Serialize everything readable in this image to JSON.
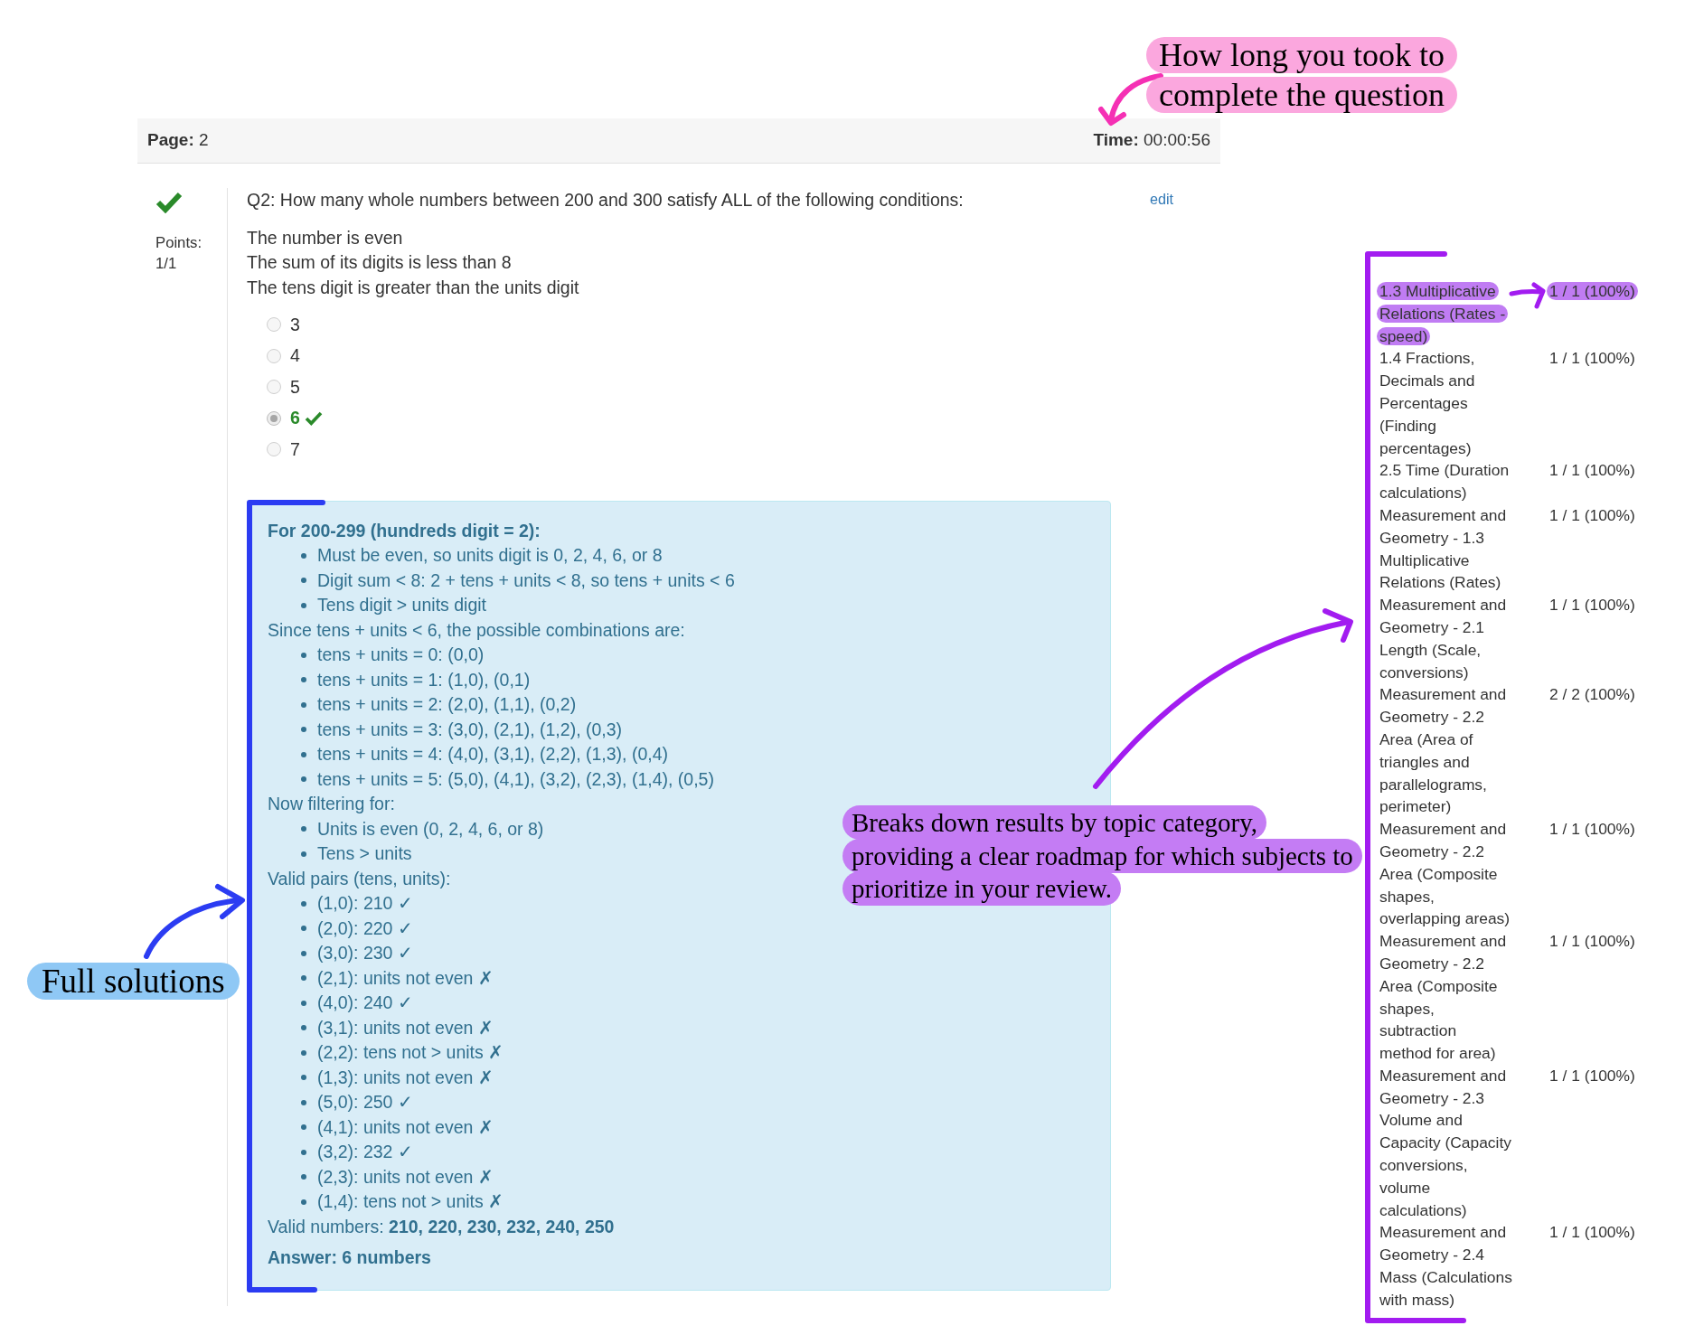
{
  "header": {
    "page": "**Page:** 2",
    "time": "**Time:** 00:00:56"
  },
  "question": {
    "correct": true,
    "points_label": "Points:",
    "points": "1/1",
    "title": "Q2: How many whole numbers between 200 and 300 satisfy ALL of the following conditions:",
    "edit_link": "edit",
    "conditions": [
      "The number is even",
      "The sum of its digits is less than 8",
      "The tens digit is greater than the units digit"
    ],
    "options": [
      {
        "label": "3",
        "selected": false,
        "correct": false
      },
      {
        "label": "4",
        "selected": false,
        "correct": false
      },
      {
        "label": "5",
        "selected": false,
        "correct": false
      },
      {
        "label": "6",
        "selected": true,
        "correct": true
      },
      {
        "label": "7",
        "selected": false,
        "correct": false
      }
    ]
  },
  "solution": {
    "lines": [
      {
        "kind": "heading",
        "text": "For 200-299 (hundreds digit = 2):"
      },
      {
        "kind": "bullet",
        "text": "Must be even, so units digit is 0, 2, 4, 6, or 8"
      },
      {
        "kind": "bullet",
        "text": "Digit sum < 8: 2 + tens + units < 8, so tens + units < 6"
      },
      {
        "kind": "bullet",
        "text": "Tens digit > units digit"
      },
      {
        "kind": "text",
        "text": "Since tens + units < 6, the possible combinations are:"
      },
      {
        "kind": "bullet",
        "text": "tens + units = 0: (0,0)"
      },
      {
        "kind": "bullet",
        "text": "tens + units = 1: (1,0), (0,1)"
      },
      {
        "kind": "bullet",
        "text": "tens + units = 2: (2,0), (1,1), (0,2)"
      },
      {
        "kind": "bullet",
        "text": "tens + units = 3: (3,0), (2,1), (1,2), (0,3)"
      },
      {
        "kind": "bullet",
        "text": "tens + units = 4: (4,0), (3,1), (2,2), (1,3), (0,4)"
      },
      {
        "kind": "bullet",
        "text": "tens + units = 5: (5,0), (4,1), (3,2), (2,3), (1,4), (0,5)"
      },
      {
        "kind": "text",
        "text": "Now filtering for:"
      },
      {
        "kind": "bullet",
        "text": "Units is even (0, 2, 4, 6, or 8)"
      },
      {
        "kind": "bullet",
        "text": "Tens > units"
      },
      {
        "kind": "text",
        "text": "Valid pairs (tens, units):"
      },
      {
        "kind": "bullet",
        "text": "(1,0): 210 ✓"
      },
      {
        "kind": "bullet",
        "text": "(2,0): 220 ✓"
      },
      {
        "kind": "bullet",
        "text": "(3,0): 230 ✓"
      },
      {
        "kind": "bullet",
        "text": "(2,1): units not even ✗"
      },
      {
        "kind": "bullet",
        "text": "(4,0): 240 ✓"
      },
      {
        "kind": "bullet",
        "text": "(3,1): units not even ✗"
      },
      {
        "kind": "bullet",
        "text": "(2,2): tens not > units ✗"
      },
      {
        "kind": "bullet",
        "text": "(1,3): units not even ✗"
      },
      {
        "kind": "bullet",
        "text": "(5,0): 250 ✓"
      },
      {
        "kind": "bullet",
        "text": "(4,1): units not even ✗"
      },
      {
        "kind": "bullet",
        "text": "(3,2): 232 ✓"
      },
      {
        "kind": "bullet",
        "text": "(2,3): units not even ✗"
      },
      {
        "kind": "bullet",
        "text": "(1,4): tens not > units ✗"
      },
      {
        "kind": "text",
        "text": "Valid numbers: **210, 220, 230, 232, 240, 250**"
      },
      {
        "kind": "answer",
        "text": "Answer: 6 numbers"
      }
    ]
  },
  "topic_results": {
    "rows": [
      {
        "topic_lines": [
          "1.3 Multiplicative",
          "Relations (Rates -",
          "speed)"
        ],
        "score": "1 / 1 (100%)",
        "highlighted": true
      },
      {
        "topic_lines": [
          "1.4 Fractions,",
          "Decimals and",
          "Percentages",
          "(Finding",
          "percentages)"
        ],
        "score": "1 / 1 (100%)",
        "highlighted": false
      },
      {
        "topic_lines": [
          "2.5 Time (Duration",
          "calculations)"
        ],
        "score": "1 / 1 (100%)",
        "highlighted": false
      },
      {
        "topic_lines": [
          "Measurement and",
          "Geometry - 1.3",
          "Multiplicative",
          "Relations (Rates)"
        ],
        "score": "1 / 1 (100%)",
        "highlighted": false
      },
      {
        "topic_lines": [
          "Measurement and",
          "Geometry - 2.1",
          "Length (Scale,",
          "conversions)"
        ],
        "score": "1 / 1 (100%)",
        "highlighted": false
      },
      {
        "topic_lines": [
          "Measurement and",
          "Geometry - 2.2",
          "Area (Area of",
          "triangles and",
          "parallelograms,",
          "perimeter)"
        ],
        "score": "2 / 2 (100%)",
        "highlighted": false
      },
      {
        "topic_lines": [
          "Measurement and",
          "Geometry - 2.2",
          "Area (Composite",
          "shapes,",
          "overlapping areas)"
        ],
        "score": "1 / 1 (100%)",
        "highlighted": false
      },
      {
        "topic_lines": [
          "Measurement and",
          "Geometry - 2.2",
          "Area (Composite",
          "shapes,",
          "subtraction",
          "method for area)"
        ],
        "score": "1 / 1 (100%)",
        "highlighted": false
      },
      {
        "topic_lines": [
          "Measurement and",
          "Geometry - 2.3",
          "Volume and",
          "Capacity (Capacity",
          "conversions,",
          "volume",
          "calculations)"
        ],
        "score": "1 / 1 (100%)",
        "highlighted": false
      },
      {
        "topic_lines": [
          "Measurement and",
          "Geometry - 2.4",
          "Mass (Calculations",
          "with mass)"
        ],
        "score": "1 / 1 (100%)",
        "highlighted": false
      }
    ]
  },
  "annotations": [
    {
      "kind": "callout",
      "lines": [
        "How long you took to",
        "complete the question"
      ],
      "color": "#fba7de"
    },
    {
      "kind": "arrow",
      "color": "#f530b4"
    },
    {
      "kind": "bracket",
      "color": "#2b3cf2"
    },
    {
      "kind": "callout",
      "lines": [
        "Full solutions"
      ],
      "color": "#8fc8f5"
    },
    {
      "kind": "arrow",
      "color": "#2b3cf2"
    },
    {
      "kind": "callout",
      "lines": [
        "Breaks down results by topic category,",
        "providing a clear roadmap for which subjects to",
        "prioritize in your review."
      ],
      "color": "#c47cf4"
    },
    {
      "kind": "arrow",
      "color": "#a21cf0"
    },
    {
      "kind": "bracket",
      "color": "#a21cf0"
    }
  ]
}
